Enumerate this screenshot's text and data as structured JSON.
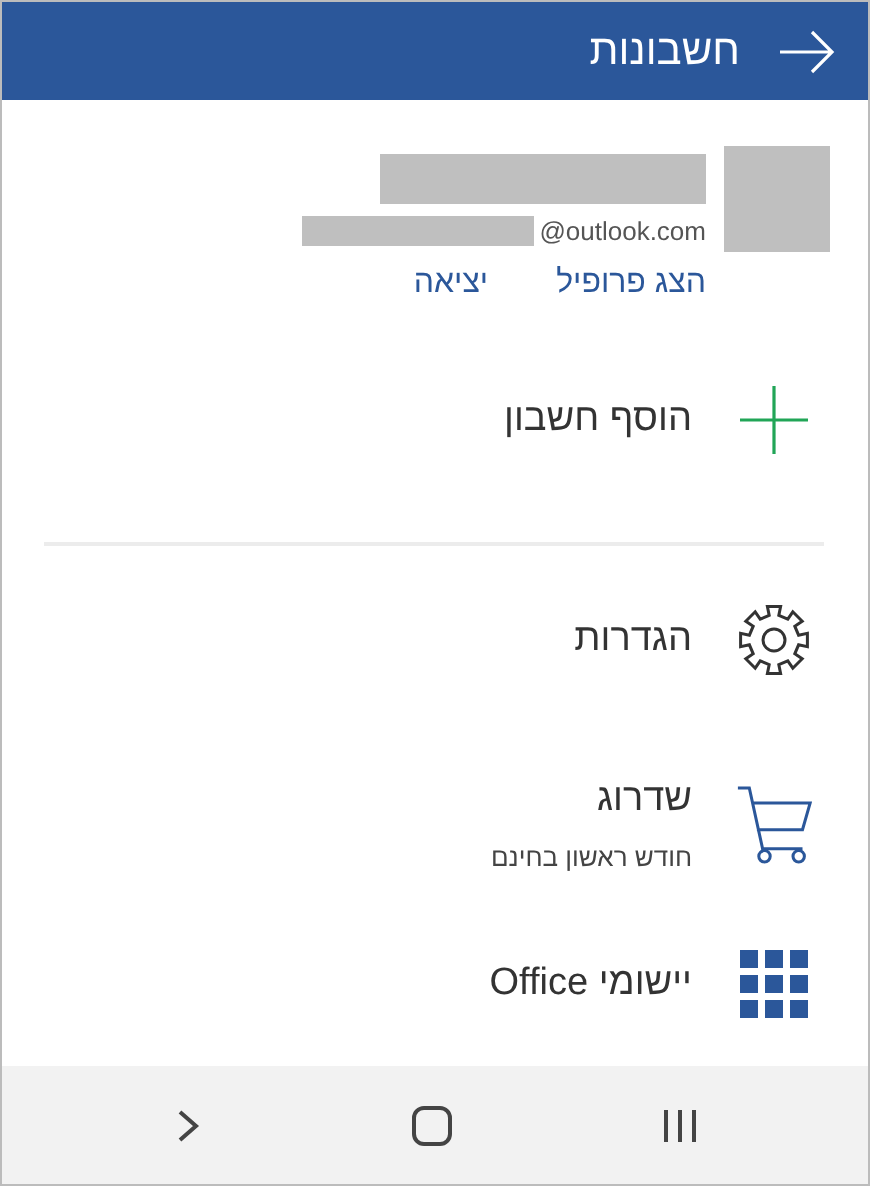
{
  "header": {
    "title": "חשבונות"
  },
  "account": {
    "email_domain": "@outlook.com",
    "links": [
      "הצג פרופיל",
      "יציאה"
    ]
  },
  "menu": [
    {
      "kind": "add",
      "label": "הוסף חשבון"
    },
    {
      "kind": "settings",
      "label": "הגדרות"
    },
    {
      "kind": "upgrade",
      "label": "שדרוג",
      "subtitle": "חודש ראשון בחינם"
    },
    {
      "kind": "apps",
      "label": "יישומי Office"
    }
  ]
}
